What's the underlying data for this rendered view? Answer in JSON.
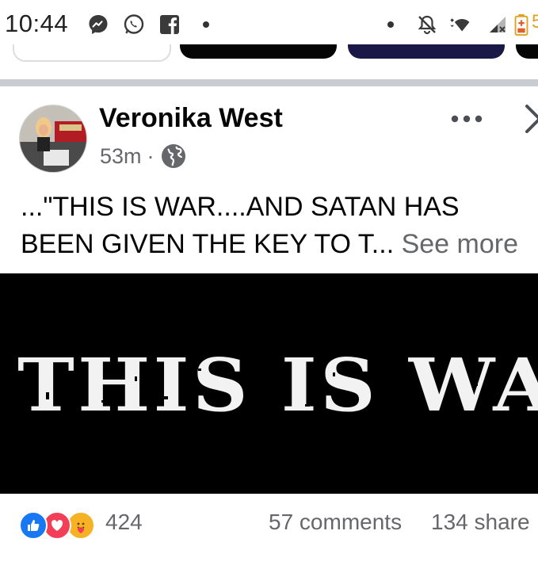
{
  "status_bar": {
    "time": "10:44",
    "battery_text": "5",
    "icons": [
      "messenger-icon",
      "whatsapp-icon",
      "facebook-icon",
      "notification-dot",
      "silent-icon",
      "wifi-icon",
      "signal-icon",
      "battery-icon"
    ]
  },
  "post": {
    "author": "Veronika West",
    "time": "53m",
    "separator": "·",
    "privacy_icon": "globe-icon",
    "caption_line1": "...\"THIS IS WAR....AND SATAN HAS",
    "caption_line2": "BEEN GIVEN THE KEY TO T...",
    "see_more": "See more",
    "image_text": "THIS IS WAR"
  },
  "footer": {
    "reaction_icons": [
      "like-icon",
      "love-icon",
      "care-icon"
    ],
    "reaction_count": "424",
    "comments": "57 comments",
    "shares": "134 share"
  },
  "colors": {
    "text": "#050505",
    "secondary": "#65676b",
    "divider": "#c9ccd1",
    "like": "#1877f2",
    "love": "#f33e58",
    "care": "#f7b125"
  }
}
